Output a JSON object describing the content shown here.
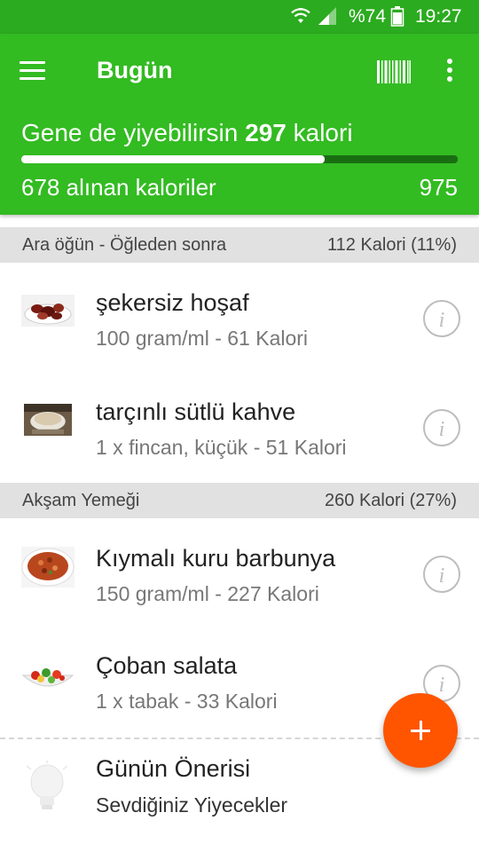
{
  "status_bar": {
    "battery": "%74",
    "time": "19:27"
  },
  "app_bar": {
    "title": "Bugün",
    "icons": [
      "menu-icon",
      "barcode-icon",
      "more-vert-icon"
    ]
  },
  "summary": {
    "remaining_prefix": "Gene de yiyebilirsin",
    "remaining_value": "297",
    "remaining_suffix": "kalori",
    "consumed_label": "678 alınan kaloriler",
    "goal": "975",
    "progress_fraction": 0.695
  },
  "sections": [
    {
      "name": "Ara öğün - Öğleden sonra",
      "calories": "112 Kalori (11%)",
      "items": [
        {
          "name": "şekersiz hoşaf",
          "detail": "100 gram/ml - 61 Kalori"
        },
        {
          "name": "tarçınlı sütlü kahve",
          "detail": "1 x fincan, küçük - 51 Kalori"
        }
      ]
    },
    {
      "name": "Akşam Yemeği",
      "calories": "260 Kalori (27%)",
      "items": [
        {
          "name": "Kıymalı kuru barbunya",
          "detail": "150 gram/ml - 227 Kalori"
        },
        {
          "name": "Çoban salata",
          "detail": "1 x tabak - 33 Kalori"
        }
      ]
    }
  ],
  "tip": {
    "title": "Günün Önerisi",
    "subtitle": "Sevdiğiniz Yiyecekler"
  },
  "colors": {
    "primary": "#33bb22",
    "status_bar": "#2bab1f",
    "fab": "#ff5500",
    "section_bg": "#e1e1e1"
  }
}
